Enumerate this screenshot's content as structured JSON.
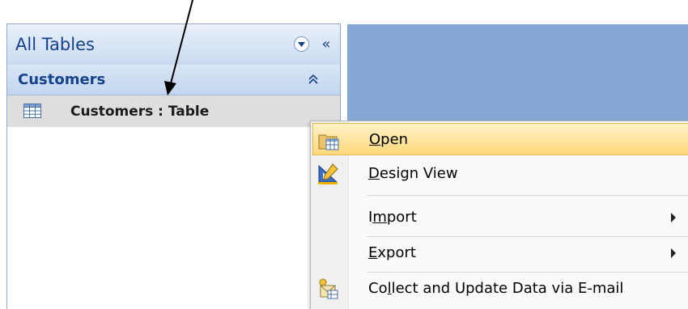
{
  "nav_pane": {
    "title": "All Tables",
    "dropdown_icon": "circle-chevron-down-icon",
    "collapse_icon": "double-chevron-left-icon",
    "collapse_glyph": "«",
    "group": {
      "label": "Customers",
      "chevron_icon": "double-chevron-up-icon"
    },
    "items": [
      {
        "label": "Customers : Table",
        "icon": "table-icon"
      }
    ]
  },
  "context_menu": {
    "items": [
      {
        "pre": "",
        "accel": "O",
        "post": "pen",
        "icon": "open-table-icon",
        "highlighted": true,
        "submenu": false
      },
      {
        "pre": "",
        "accel": "D",
        "post": "esign View",
        "icon": "design-view-icon",
        "highlighted": false,
        "submenu": false
      },
      {
        "pre": "I",
        "accel": "m",
        "post": "port",
        "icon": "",
        "highlighted": false,
        "submenu": true
      },
      {
        "pre": "",
        "accel": "E",
        "post": "xport",
        "icon": "",
        "highlighted": false,
        "submenu": true
      },
      {
        "pre": "Co",
        "accel": "l",
        "post": "lect and Update Data via E-mail",
        "icon": "collect-data-icon",
        "highlighted": false,
        "submenu": false
      }
    ]
  },
  "colors": {
    "workspace": "#86a8d6",
    "nav_text": "#15428b",
    "highlight": "#ffd97a"
  }
}
